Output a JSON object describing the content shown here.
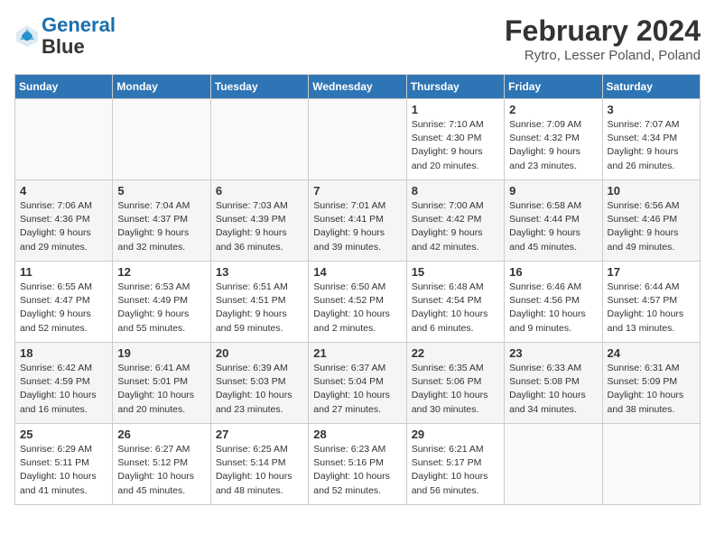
{
  "header": {
    "logo_line1": "General",
    "logo_line2": "Blue",
    "month": "February 2024",
    "location": "Rytro, Lesser Poland, Poland"
  },
  "days_of_week": [
    "Sunday",
    "Monday",
    "Tuesday",
    "Wednesday",
    "Thursday",
    "Friday",
    "Saturday"
  ],
  "weeks": [
    [
      {
        "day": "",
        "info": ""
      },
      {
        "day": "",
        "info": ""
      },
      {
        "day": "",
        "info": ""
      },
      {
        "day": "",
        "info": ""
      },
      {
        "day": "1",
        "info": "Sunrise: 7:10 AM\nSunset: 4:30 PM\nDaylight: 9 hours\nand 20 minutes."
      },
      {
        "day": "2",
        "info": "Sunrise: 7:09 AM\nSunset: 4:32 PM\nDaylight: 9 hours\nand 23 minutes."
      },
      {
        "day": "3",
        "info": "Sunrise: 7:07 AM\nSunset: 4:34 PM\nDaylight: 9 hours\nand 26 minutes."
      }
    ],
    [
      {
        "day": "4",
        "info": "Sunrise: 7:06 AM\nSunset: 4:36 PM\nDaylight: 9 hours\nand 29 minutes."
      },
      {
        "day": "5",
        "info": "Sunrise: 7:04 AM\nSunset: 4:37 PM\nDaylight: 9 hours\nand 32 minutes."
      },
      {
        "day": "6",
        "info": "Sunrise: 7:03 AM\nSunset: 4:39 PM\nDaylight: 9 hours\nand 36 minutes."
      },
      {
        "day": "7",
        "info": "Sunrise: 7:01 AM\nSunset: 4:41 PM\nDaylight: 9 hours\nand 39 minutes."
      },
      {
        "day": "8",
        "info": "Sunrise: 7:00 AM\nSunset: 4:42 PM\nDaylight: 9 hours\nand 42 minutes."
      },
      {
        "day": "9",
        "info": "Sunrise: 6:58 AM\nSunset: 4:44 PM\nDaylight: 9 hours\nand 45 minutes."
      },
      {
        "day": "10",
        "info": "Sunrise: 6:56 AM\nSunset: 4:46 PM\nDaylight: 9 hours\nand 49 minutes."
      }
    ],
    [
      {
        "day": "11",
        "info": "Sunrise: 6:55 AM\nSunset: 4:47 PM\nDaylight: 9 hours\nand 52 minutes."
      },
      {
        "day": "12",
        "info": "Sunrise: 6:53 AM\nSunset: 4:49 PM\nDaylight: 9 hours\nand 55 minutes."
      },
      {
        "day": "13",
        "info": "Sunrise: 6:51 AM\nSunset: 4:51 PM\nDaylight: 9 hours\nand 59 minutes."
      },
      {
        "day": "14",
        "info": "Sunrise: 6:50 AM\nSunset: 4:52 PM\nDaylight: 10 hours\nand 2 minutes."
      },
      {
        "day": "15",
        "info": "Sunrise: 6:48 AM\nSunset: 4:54 PM\nDaylight: 10 hours\nand 6 minutes."
      },
      {
        "day": "16",
        "info": "Sunrise: 6:46 AM\nSunset: 4:56 PM\nDaylight: 10 hours\nand 9 minutes."
      },
      {
        "day": "17",
        "info": "Sunrise: 6:44 AM\nSunset: 4:57 PM\nDaylight: 10 hours\nand 13 minutes."
      }
    ],
    [
      {
        "day": "18",
        "info": "Sunrise: 6:42 AM\nSunset: 4:59 PM\nDaylight: 10 hours\nand 16 minutes."
      },
      {
        "day": "19",
        "info": "Sunrise: 6:41 AM\nSunset: 5:01 PM\nDaylight: 10 hours\nand 20 minutes."
      },
      {
        "day": "20",
        "info": "Sunrise: 6:39 AM\nSunset: 5:03 PM\nDaylight: 10 hours\nand 23 minutes."
      },
      {
        "day": "21",
        "info": "Sunrise: 6:37 AM\nSunset: 5:04 PM\nDaylight: 10 hours\nand 27 minutes."
      },
      {
        "day": "22",
        "info": "Sunrise: 6:35 AM\nSunset: 5:06 PM\nDaylight: 10 hours\nand 30 minutes."
      },
      {
        "day": "23",
        "info": "Sunrise: 6:33 AM\nSunset: 5:08 PM\nDaylight: 10 hours\nand 34 minutes."
      },
      {
        "day": "24",
        "info": "Sunrise: 6:31 AM\nSunset: 5:09 PM\nDaylight: 10 hours\nand 38 minutes."
      }
    ],
    [
      {
        "day": "25",
        "info": "Sunrise: 6:29 AM\nSunset: 5:11 PM\nDaylight: 10 hours\nand 41 minutes."
      },
      {
        "day": "26",
        "info": "Sunrise: 6:27 AM\nSunset: 5:12 PM\nDaylight: 10 hours\nand 45 minutes."
      },
      {
        "day": "27",
        "info": "Sunrise: 6:25 AM\nSunset: 5:14 PM\nDaylight: 10 hours\nand 48 minutes."
      },
      {
        "day": "28",
        "info": "Sunrise: 6:23 AM\nSunset: 5:16 PM\nDaylight: 10 hours\nand 52 minutes."
      },
      {
        "day": "29",
        "info": "Sunrise: 6:21 AM\nSunset: 5:17 PM\nDaylight: 10 hours\nand 56 minutes."
      },
      {
        "day": "",
        "info": ""
      },
      {
        "day": "",
        "info": ""
      }
    ]
  ]
}
